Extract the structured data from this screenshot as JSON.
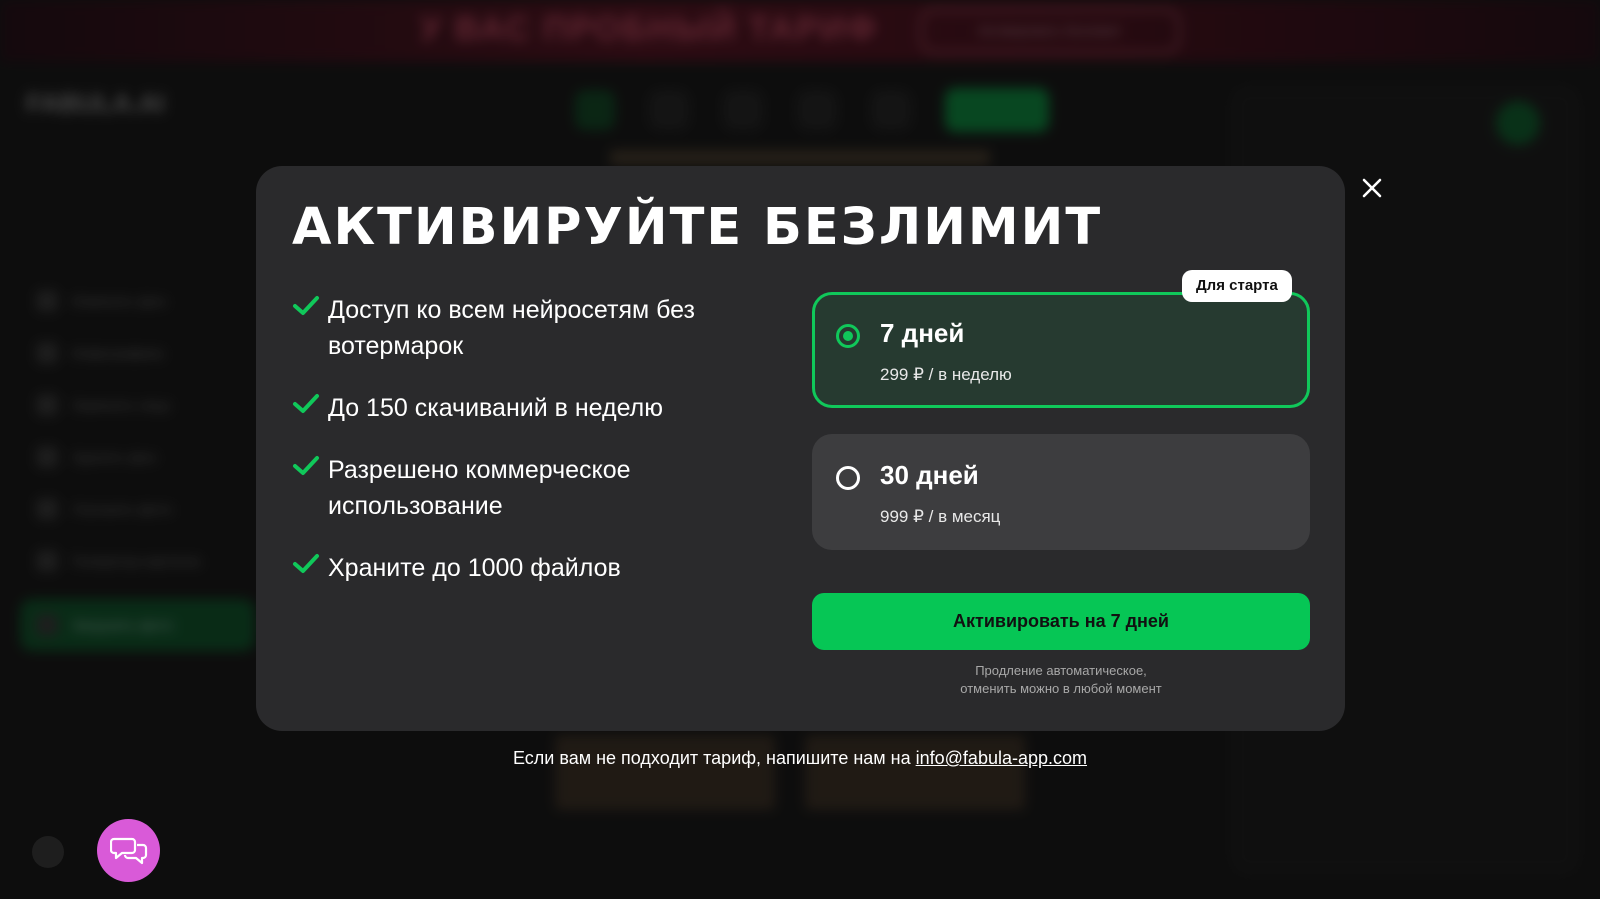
{
  "background": {
    "banner_text": "У ВАС ПРОБНЫЙ ТАРИФ",
    "banner_button": "Активировать безлимит",
    "logo": "FABULA.AI",
    "sidebar_items": [
      "Изменить фон",
      "Инфографика",
      "Заменить лицо",
      "Удалить фон",
      "Улучшить фото",
      "Генератор картинок",
      "Загрузить фото"
    ]
  },
  "modal": {
    "title": "АКТИВИРУЙТЕ БЕЗЛИМИТ",
    "close_icon": "close-icon",
    "features": [
      "Доступ ко всем нейросетям без вотермарок",
      "До 150 скачиваний в неделю",
      "Разрешено коммерческое использование",
      "Храните до 1000 файлов"
    ],
    "plans": [
      {
        "name": "7 дней",
        "price": "299 ₽ / в неделю",
        "selected": true
      },
      {
        "name": "30 дней",
        "price": "999 ₽ / в месяц",
        "selected": false
      }
    ],
    "badge": "Для старта",
    "cta": "Активировать на 7 дней",
    "note_line1": "Продление автоматическое,",
    "note_line2": "отменить можно в любой момент"
  },
  "footer": {
    "text": "Если вам не подходит тариф, напишите нам на ",
    "email": "info@fabula-app.com"
  },
  "colors": {
    "accent_green": "#06c655",
    "modal_bg": "#2a2a2c",
    "chat_fab": "#d95ad8"
  }
}
